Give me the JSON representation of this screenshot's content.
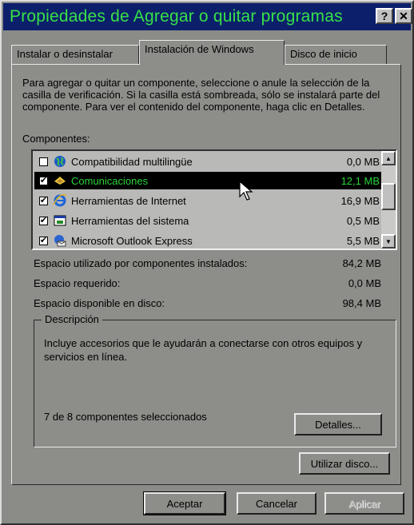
{
  "window": {
    "title": "Propiedades de Agregar o quitar programas",
    "help_btn": "?",
    "close_btn": "✕"
  },
  "tabs": [
    {
      "label": "Instalar o desinstalar"
    },
    {
      "label": "Instalación de Windows"
    },
    {
      "label": "Disco de inicio"
    }
  ],
  "description": "Para agregar o quitar un componente, seleccione o anule la selección de la casilla de verificación. Si la casilla está sombreada, sólo se instalará parte del componente. Para ver el contenido del componente, haga clic en Detalles.",
  "components_label": "Componentes:",
  "components": [
    {
      "name": "Compatibilidad multilingüe",
      "size": "0,0 MB",
      "checked": false,
      "icon": "globe-icon"
    },
    {
      "name": "Comunicaciones",
      "size": "12,1 MB",
      "checked": true,
      "icon": "communications-icon"
    },
    {
      "name": "Herramientas de Internet",
      "size": "16,9 MB",
      "checked": true,
      "icon": "internet-explorer-icon"
    },
    {
      "name": "Herramientas del sistema",
      "size": "0,5 MB",
      "checked": true,
      "icon": "system-tools-icon"
    },
    {
      "name": "Microsoft Outlook Express",
      "size": "5,5 MB",
      "checked": true,
      "icon": "outlook-express-icon"
    }
  ],
  "space": {
    "used_label": "Espacio utilizado por componentes instalados:",
    "used_value": "84,2 MB",
    "required_label": "Espacio requerido:",
    "required_value": "0,0 MB",
    "available_label": "Espacio disponible en disco:",
    "available_value": "98,4 MB"
  },
  "group": {
    "title": "Descripción",
    "text": "Incluye accesorios que le ayudarán a conectarse con otros equipos y servicios en línea.",
    "selected_count": "7 de 8 componentes seleccionados"
  },
  "buttons": {
    "details": "Detalles...",
    "use_disk": "Utilizar disco...",
    "ok": "Aceptar",
    "cancel": "Cancelar",
    "apply": "Aplicar"
  },
  "colors": {
    "titlebar_bg": "#0b1f6b",
    "titlebar_text": "#39e048",
    "selection_bg": "#000000",
    "selection_text": "#2ad43a",
    "dialog_bg": "#8d8d8a"
  }
}
